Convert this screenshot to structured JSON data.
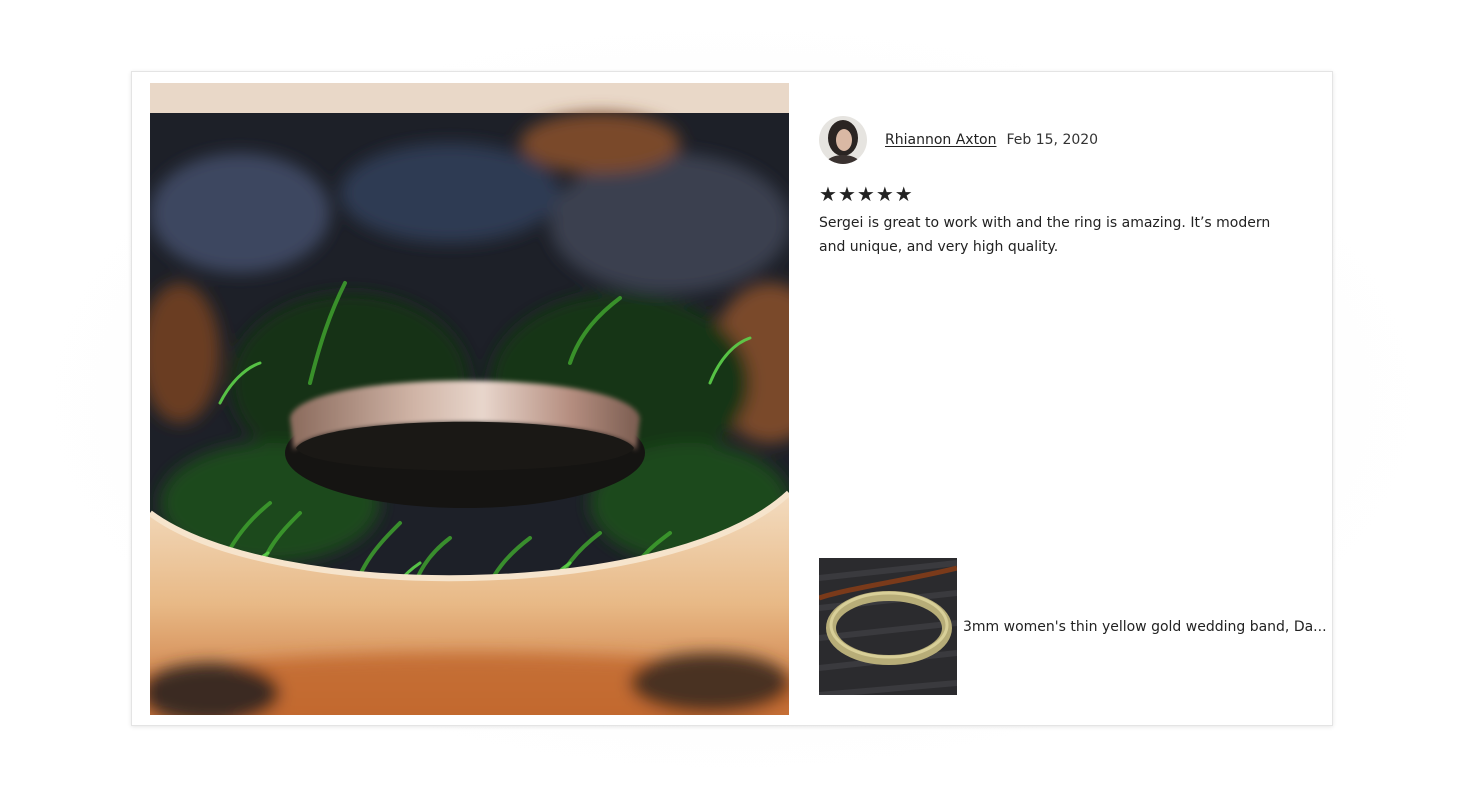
{
  "review": {
    "reviewer_name": "Rhiannon Axton",
    "date": "Feb 15, 2020",
    "rating": 5,
    "rating_stars": "★★★★★",
    "text": "Sergei is great to work with and the ring is amazing. It’s modern and unique, and very high quality."
  },
  "product": {
    "title": "3mm women's thin yellow gold wedding band, Da..."
  },
  "colors": {
    "text": "#222222",
    "card_border": "#e4e4e4"
  },
  "icons": {
    "star": "star-icon"
  }
}
